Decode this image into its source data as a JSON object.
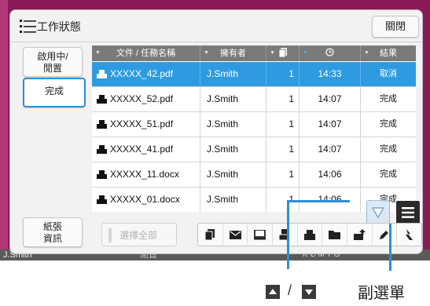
{
  "window": {
    "title": "工作狀態",
    "close_label": "關閉"
  },
  "sidebar": {
    "items": [
      {
        "label": "啟用中/\n閒置",
        "active": false
      },
      {
        "label": "完成",
        "active": true
      }
    ],
    "paper_info_label": "紙張\n資訊"
  },
  "table": {
    "headers": [
      "文件 / 任務名稱",
      "擁有者",
      "",
      "",
      "結果"
    ],
    "rows": [
      {
        "name": "XXXXX_42.pdf",
        "owner": "J.Smith",
        "copies": "1",
        "time": "14:33",
        "result": "取消",
        "selected": true
      },
      {
        "name": "XXXXX_52.pdf",
        "owner": "J.Smith",
        "copies": "1",
        "time": "14:07",
        "result": "完成",
        "selected": false
      },
      {
        "name": "XXXXX_51.pdf",
        "owner": "J.Smith",
        "copies": "1",
        "time": "14:07",
        "result": "完成",
        "selected": false
      },
      {
        "name": "XXXXX_41.pdf",
        "owner": "J.Smith",
        "copies": "1",
        "time": "14:07",
        "result": "完成",
        "selected": false
      },
      {
        "name": "XXXXX_11.docx",
        "owner": "J.Smith",
        "copies": "1",
        "time": "14:06",
        "result": "完成",
        "selected": false
      },
      {
        "name": "XXXXX_01.docx",
        "owner": "J.Smith",
        "copies": "1",
        "time": "14:06",
        "result": "完成",
        "selected": false
      }
    ]
  },
  "toolbar": {
    "select_all_label": "選擇全部",
    "tools": [
      "copy-icon",
      "mail-icon",
      "pc-icon",
      "scan-icon",
      "print-icon",
      "folder-icon",
      "upload-icon",
      "pen-icon",
      "settings-icon"
    ]
  },
  "statusbar": {
    "user": "J.Smith",
    "status": "閒置",
    "ink": "K C M Y G"
  },
  "callouts": {
    "submenu_label": "副選單"
  },
  "colors": {
    "accent": "#2e9be0",
    "header": "#7a7a7a",
    "bezel": "#8a1a55"
  }
}
